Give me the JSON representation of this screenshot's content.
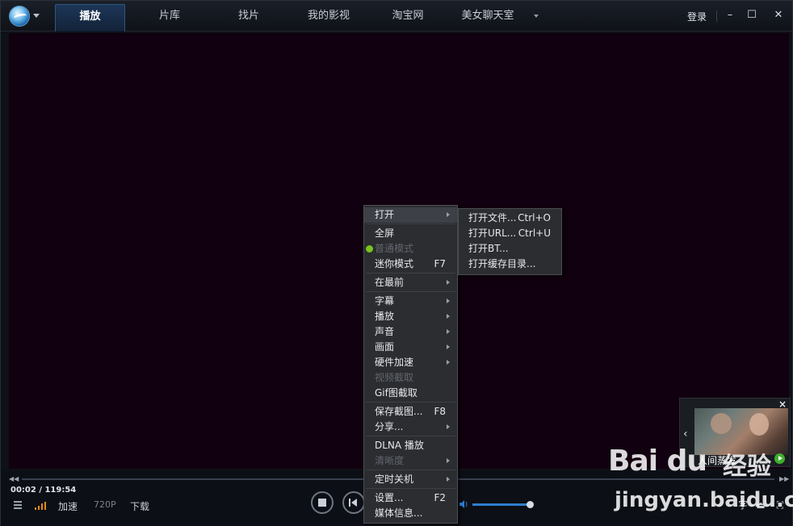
{
  "topbar": {
    "tabs": [
      "播放",
      "片库",
      "找片",
      "我的影视",
      "淘宝网",
      "美女聊天室"
    ],
    "login": "登录",
    "window_buttons": {
      "minimize": "–",
      "maximize": "☐",
      "close": "✕"
    }
  },
  "player": {
    "time_current": "00:02",
    "time_total": "/ 119:54",
    "speed_label": "加速",
    "quality_label": "720P",
    "download_label": "下载",
    "volume_fraction": 0.98
  },
  "ad": {
    "title": "人间蒸发",
    "close": "×",
    "prev": "‹"
  },
  "context_menu": {
    "items": [
      {
        "label": "打开",
        "shortcut": "",
        "submenu": true,
        "disabled": false,
        "highlighted": true
      },
      {
        "label": "全屏",
        "shortcut": "",
        "submenu": false,
        "disabled": false
      },
      {
        "label": "普通模式",
        "shortcut": "",
        "submenu": false,
        "disabled": true,
        "checked": true
      },
      {
        "label": "迷你模式",
        "shortcut": "F7",
        "submenu": false,
        "disabled": false
      },
      {
        "label": "在最前",
        "shortcut": "",
        "submenu": true,
        "disabled": false
      },
      {
        "label": "字幕",
        "shortcut": "",
        "submenu": true,
        "disabled": false
      },
      {
        "label": "播放",
        "shortcut": "",
        "submenu": true,
        "disabled": false
      },
      {
        "label": "声音",
        "shortcut": "",
        "submenu": true,
        "disabled": false
      },
      {
        "label": "画面",
        "shortcut": "",
        "submenu": true,
        "disabled": false
      },
      {
        "label": "硬件加速",
        "shortcut": "",
        "submenu": true,
        "disabled": false
      },
      {
        "label": "视频截取",
        "shortcut": "",
        "submenu": false,
        "disabled": true
      },
      {
        "label": "Gif图截取",
        "shortcut": "",
        "submenu": false,
        "disabled": false
      },
      {
        "label": "保存截图...",
        "shortcut": "F8",
        "submenu": false,
        "disabled": false
      },
      {
        "label": "分享...",
        "shortcut": "",
        "submenu": true,
        "disabled": false
      },
      {
        "label": "DLNA 播放",
        "shortcut": "",
        "submenu": false,
        "disabled": false
      },
      {
        "label": "清晰度",
        "shortcut": "",
        "submenu": true,
        "disabled": true
      },
      {
        "label": "定时关机",
        "shortcut": "",
        "submenu": true,
        "disabled": false
      },
      {
        "label": "设置...",
        "shortcut": "F2",
        "submenu": false,
        "disabled": false
      },
      {
        "label": "媒体信息...",
        "shortcut": "",
        "submenu": false,
        "disabled": false
      }
    ]
  },
  "open_submenu": {
    "items": [
      {
        "label": "打开文件...",
        "shortcut": "Ctrl+O"
      },
      {
        "label": "打开URL...",
        "shortcut": "Ctrl+U"
      },
      {
        "label": "打开BT...",
        "shortcut": ""
      },
      {
        "label": "打开缓存目录...",
        "shortcut": ""
      }
    ]
  },
  "watermark": {
    "brand": "Bai du",
    "cn": "经验",
    "url": "jingyan.baidu.com"
  }
}
